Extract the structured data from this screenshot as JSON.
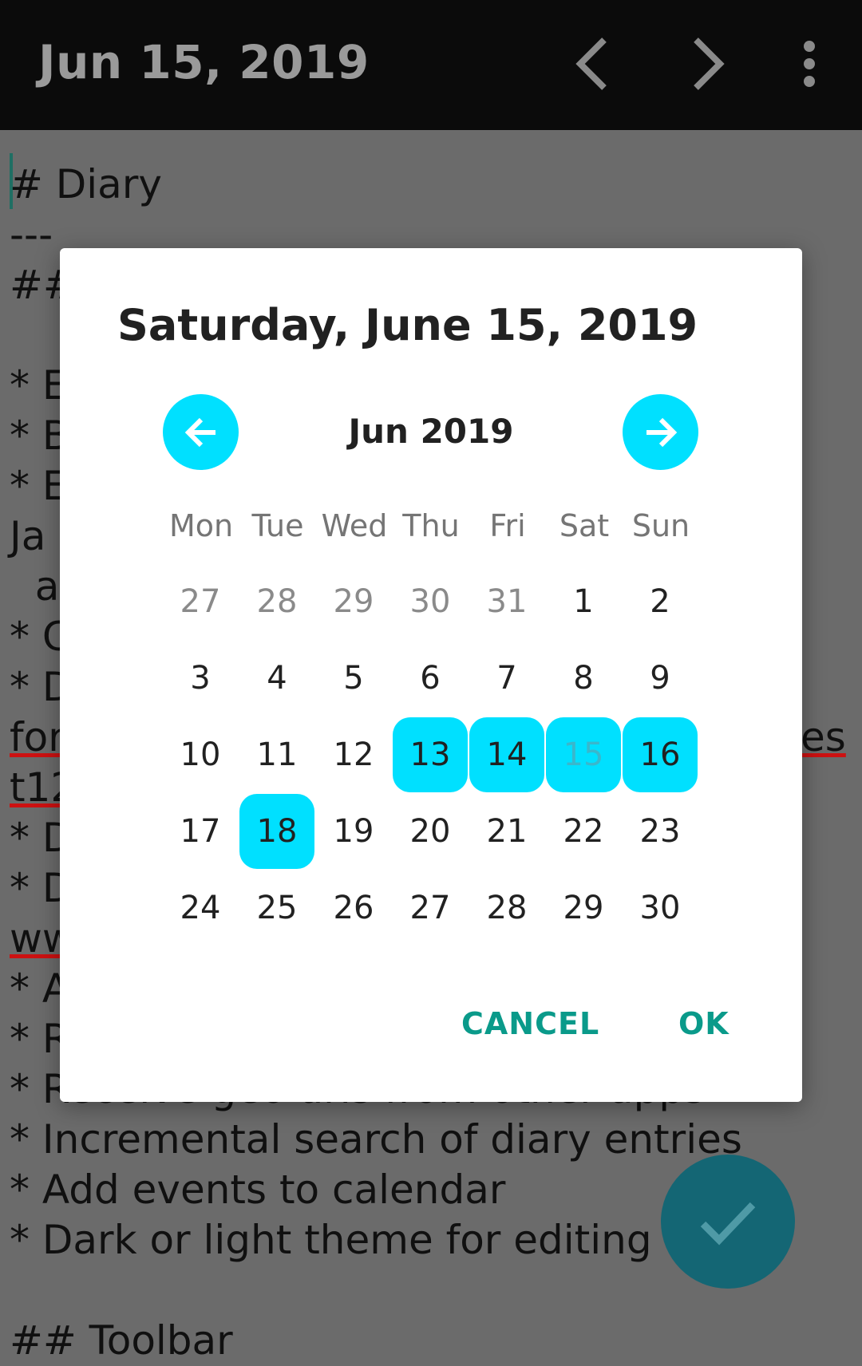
{
  "toolbar": {
    "title": "Jun 15, 2019",
    "icons": [
      "chevron-left-icon",
      "chevron-right-icon",
      "more-vert-icon"
    ]
  },
  "editor": {
    "lines": [
      "# Diary",
      "---",
      "##",
      "",
      "* E",
      "* B",
      "* E",
      "Ja",
      "  ar",
      "* C",
      "* D",
      "for",
      "t12",
      "* D",
      "* D",
      "ww",
      "* A",
      "* R",
      "* Receive geo uris from other apps",
      "* Incremental search of diary entries",
      "* Add events to calendar",
      "* Dark or light theme for editing",
      "",
      "## Toolbar"
    ],
    "right_fragment": "es"
  },
  "dialog": {
    "title": "Saturday, June 15, 2019",
    "month_label": "Jun 2019",
    "weekdays": [
      "Mon",
      "Tue",
      "Wed",
      "Thu",
      "Fri",
      "Sat",
      "Sun"
    ],
    "weeks": [
      [
        "27",
        "28",
        "29",
        "30",
        "31",
        "1",
        "2"
      ],
      [
        "3",
        "4",
        "5",
        "6",
        "7",
        "8",
        "9"
      ],
      [
        "10",
        "11",
        "12",
        "13",
        "14",
        "15",
        "16"
      ],
      [
        "17",
        "18",
        "19",
        "20",
        "21",
        "22",
        "23"
      ],
      [
        "24",
        "25",
        "26",
        "27",
        "28",
        "29",
        "30"
      ]
    ],
    "highlighted_days": [
      "13",
      "14",
      "15",
      "16",
      "18"
    ],
    "selected_day": "15",
    "cancel_label": "CANCEL",
    "ok_label": "OK"
  },
  "fab": {
    "icon": "check-icon"
  },
  "colors": {
    "accent": "#00e0ff",
    "button_text": "#0a9a8a",
    "fab": "#146674",
    "toolbar": "#0b0b0b",
    "scrim": "#6b6b6b"
  }
}
